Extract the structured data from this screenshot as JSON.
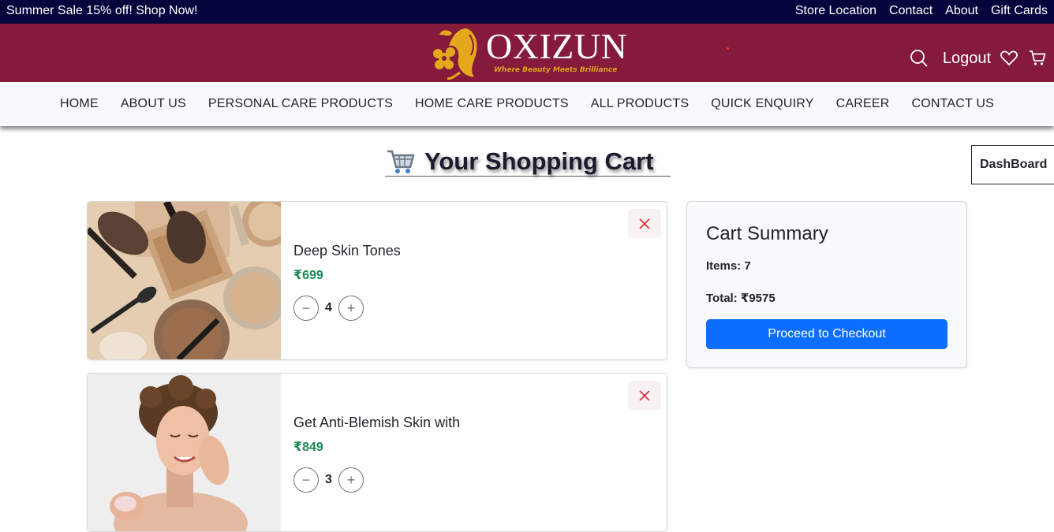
{
  "topbar": {
    "promo": "Summer Sale 15% off! Shop Now!",
    "links": [
      "Store Location",
      "Contact",
      "About",
      "Gift Cards"
    ]
  },
  "header": {
    "brand": "OXIZUN",
    "tagline": "Where Beauty Meets Brilliance",
    "logout_label": "Logout",
    "icons": [
      "search-icon",
      "heart-icon",
      "cart-icon"
    ],
    "brand_color": "#851a3a",
    "topbar_color": "#05053d"
  },
  "nav": {
    "items": [
      "HOME",
      "ABOUT US",
      "PERSONAL CARE PRODUCTS",
      "HOME CARE PRODUCTS",
      "ALL PRODUCTS",
      "QUICK ENQUIRY",
      "CAREER",
      "CONTACT US"
    ]
  },
  "page": {
    "title": "Your Shopping Cart",
    "title_icon": "shopping-cart-emoji",
    "dashboard_label": "DashBoard"
  },
  "cart": {
    "items": [
      {
        "name": "Deep Skin Tones",
        "price": "₹699",
        "quantity": "4",
        "image": "makeup-brushes-powder"
      },
      {
        "name": "Get Anti-Blemish Skin with",
        "price": "₹849",
        "quantity": "3",
        "image": "woman-applying-cream"
      }
    ],
    "decrement_glyph": "−",
    "increment_glyph": "+",
    "price_color": "#198754"
  },
  "summary": {
    "heading": "Cart Summary",
    "items_text": "Items: 7",
    "total_text": "Total: ₹9575",
    "checkout_label": "Proceed to Checkout",
    "button_color": "#0d6efd"
  }
}
